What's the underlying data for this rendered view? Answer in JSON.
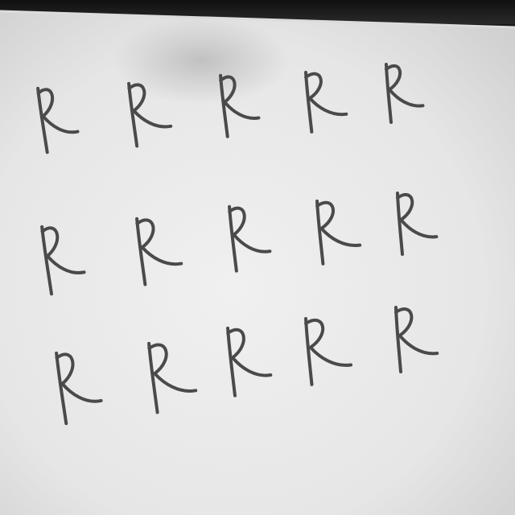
{
  "photo": {
    "subject": "handwritten-letter-grid",
    "ink_color": "#4a4a4a",
    "paper_color": "#e9e9e9",
    "letters": [
      [
        "R",
        "R",
        "R",
        "R",
        "R"
      ],
      [
        "R",
        "R",
        "R",
        "R",
        "R"
      ],
      [
        "R",
        "R",
        "R",
        "R",
        "R"
      ]
    ]
  }
}
